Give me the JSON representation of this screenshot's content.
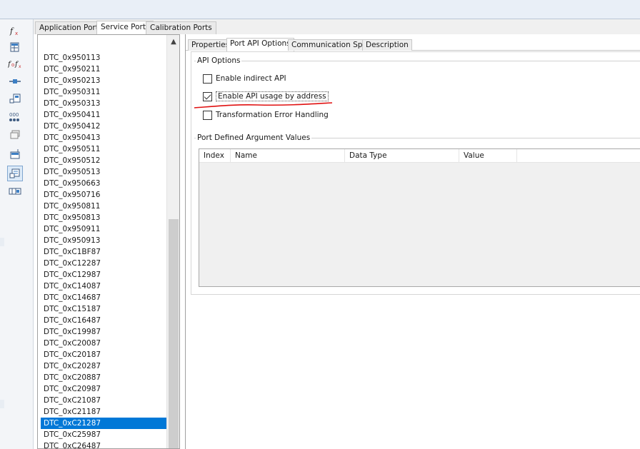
{
  "outer_tabs": [
    {
      "label": "Application Ports"
    },
    {
      "label": "Service Ports"
    },
    {
      "label": "Calibration Ports"
    }
  ],
  "toolbar_icons": [
    "function-icon",
    "table-icon",
    "function-compose-icon",
    "port-connector-icon",
    "component-grid-icon",
    "data-array-icon",
    "stack-icon",
    "database-icon",
    "service-port-icon",
    "component-list-icon"
  ],
  "dtc_list": [
    "DTC_0x950113",
    "DTC_0x950211",
    "DTC_0x950213",
    "DTC_0x950311",
    "DTC_0x950313",
    "DTC_0x950411",
    "DTC_0x950412",
    "DTC_0x950413",
    "DTC_0x950511",
    "DTC_0x950512",
    "DTC_0x950513",
    "DTC_0x950663",
    "DTC_0x950716",
    "DTC_0x950811",
    "DTC_0x950813",
    "DTC_0x950911",
    "DTC_0x950913",
    "DTC_0xC1BF87",
    "DTC_0xC12287",
    "DTC_0xC12987",
    "DTC_0xC14087",
    "DTC_0xC14687",
    "DTC_0xC15187",
    "DTC_0xC16487",
    "DTC_0xC19987",
    "DTC_0xC20087",
    "DTC_0xC20187",
    "DTC_0xC20287",
    "DTC_0xC20887",
    "DTC_0xC20987",
    "DTC_0xC21087",
    "DTC_0xC21187",
    "DTC_0xC21287",
    "DTC_0xC25987",
    "DTC_0xC26487"
  ],
  "selected_dtc": "DTC_0xC21287",
  "inner_tabs": [
    {
      "label": "Properties"
    },
    {
      "label": "Port API Options"
    },
    {
      "label": "Communication Spec"
    },
    {
      "label": "Description"
    }
  ],
  "api_options": {
    "title": "API Options",
    "enable_indirect_api": {
      "label": "Enable indirect API",
      "checked": false
    },
    "enable_api_usage_by_address": {
      "label": "Enable API usage by address",
      "checked": true
    },
    "transformation_error_handling": {
      "label": "Transformation Error Handling",
      "checked": false
    }
  },
  "port_defined_args": {
    "title": "Port Defined Argument Values",
    "columns": [
      "Index",
      "Name",
      "Data Type",
      "Value"
    ]
  },
  "colors": {
    "selection": "#0078d7",
    "annotation": "#e01010"
  }
}
